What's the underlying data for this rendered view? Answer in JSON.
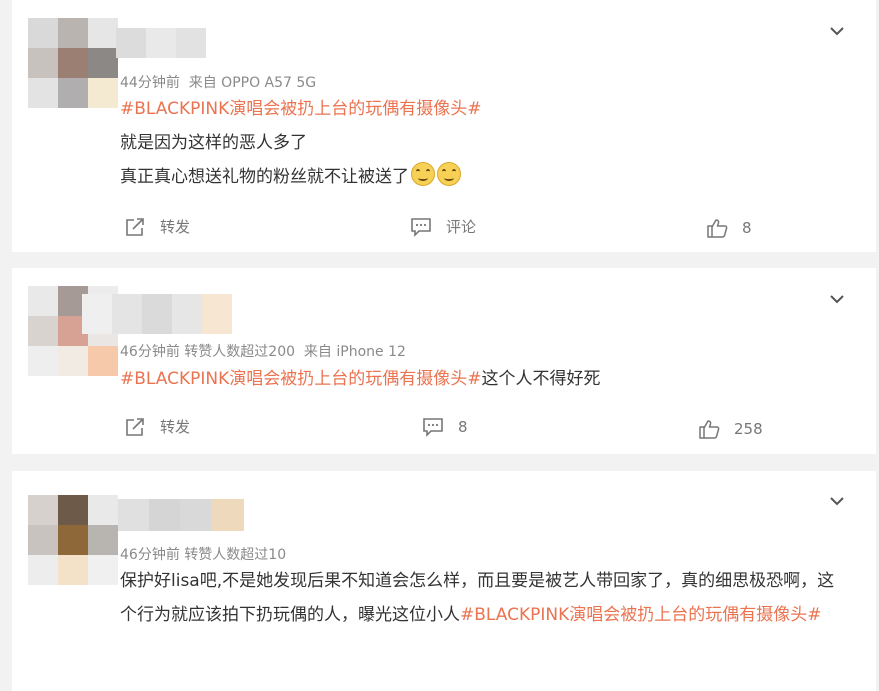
{
  "comments": [
    {
      "time": "44分钟前",
      "source": "来自 OPPO A57 5G",
      "tag": "#BLACKPINK演唱会被扔上台的玩偶有摄像头#",
      "lines": [
        "就是因为这样的恶人多了",
        "真正真心想送礼物的粉丝就不让被送了"
      ],
      "repost_label": "转发",
      "comment_label": "评论",
      "likes": "8"
    },
    {
      "time": "46分钟前",
      "badge": "转赞人数超过200",
      "source": "来自 iPhone 12",
      "tag": "#BLACKPINK演唱会被扔上台的玩偶有摄像头#",
      "text_after": "这个人不得好死",
      "repost_label": "转发",
      "comment_count": "8",
      "likes": "258"
    },
    {
      "time": "46分钟前",
      "badge": "转赞人数超过10",
      "text_main": "保护好lisa吧,不是她发现后果不知道会怎么样，而且要是被艺人带回家了，真的细思极恐啊，这个行为就应该拍下扔玩偶的人，曝光这位小人",
      "tag": "#BLACKPINK演唱会被扔上台的玩偶有摄像头#"
    }
  ],
  "icons": {
    "expand": "chevron-down-icon",
    "repost": "repost-icon",
    "comment": "comment-icon",
    "like": "thumbs-up-icon",
    "emoji": "smile-emoji-icon"
  },
  "colors": {
    "tag": "#eb7350",
    "text": "#333333",
    "meta": "#8a8a8a",
    "background": "#f2f2f2"
  }
}
